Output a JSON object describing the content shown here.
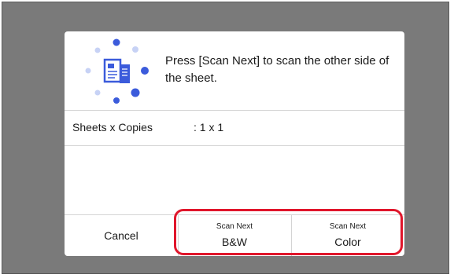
{
  "dialog": {
    "message": "Press [Scan Next] to scan the other side of the sheet.",
    "icon": "scan-next-side-icon",
    "info": {
      "label": "Sheets x Copies",
      "value": ": 1 x 1"
    }
  },
  "buttons": {
    "cancel": "Cancel",
    "bw": {
      "top": "Scan Next",
      "main": "B&W"
    },
    "color": {
      "top": "Scan Next",
      "main": "Color"
    }
  },
  "colors": {
    "background": "#7a7a7a",
    "dialog": "#ffffff",
    "highlight": "#e0162b",
    "icon_blue": "#3b5bdb",
    "icon_light": "#c7d2f5"
  }
}
